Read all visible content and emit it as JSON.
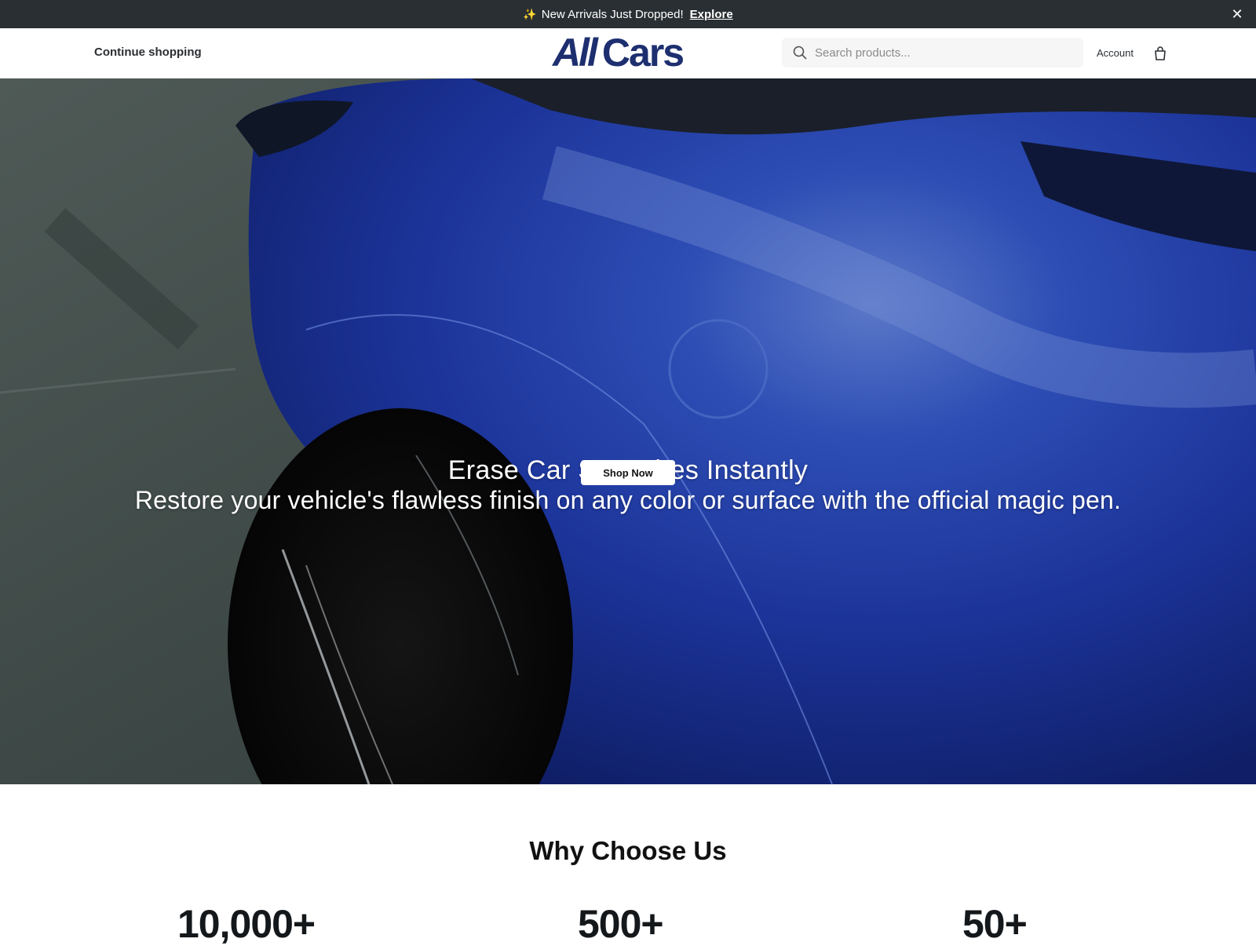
{
  "announcement": {
    "text": "New Arrivals Just Dropped!",
    "link_label": "Explore",
    "sparkle_icon": "sparkle-icon",
    "close_icon": "close-icon"
  },
  "header": {
    "continue_label": "Continue shopping",
    "logo_part1": "All",
    "logo_part2": "Cars",
    "search_placeholder": "Search products...",
    "account_label": "Account",
    "brand_color": "#1d2f6f"
  },
  "hero": {
    "title": "Erase Car Scratches Instantly",
    "subtitle": "Restore your vehicle's flawless finish on any color or surface with the official magic pen.",
    "cta_label": "Shop Now"
  },
  "why": {
    "title": "Why Choose Us",
    "stats": [
      "10,000+",
      "500+",
      "50+"
    ]
  }
}
